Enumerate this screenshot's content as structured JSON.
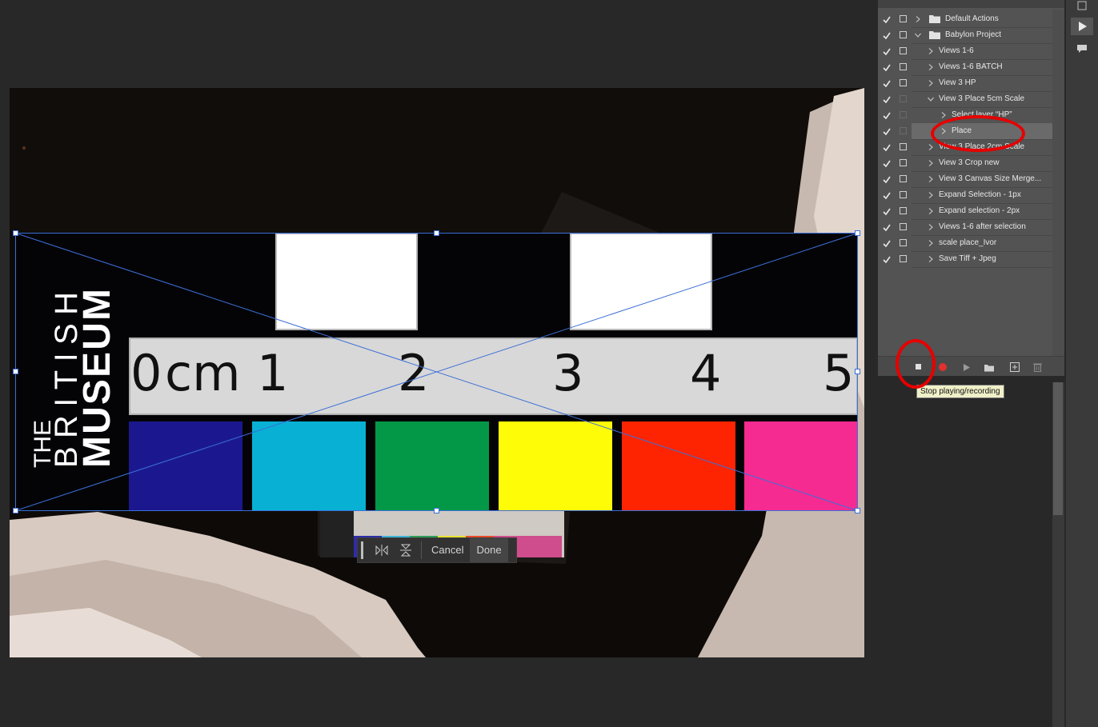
{
  "canvas_toolbar": {
    "cancel_label": "Cancel",
    "done_label": "Done"
  },
  "scale_image": {
    "museum_text": [
      "THE",
      "BRITISH",
      "MUSEUM"
    ],
    "ruler_numbers": [
      "0",
      "cm",
      "1",
      "2",
      "3",
      "4",
      "5"
    ],
    "swatch_colors": [
      "#1b188f",
      "#08b1d4",
      "#039847",
      "#fffc08",
      "#fe2402",
      "#f62b91"
    ]
  },
  "actions_panel": {
    "items": [
      {
        "label": "Default Actions",
        "type": "set",
        "indent": 0,
        "expanded": false,
        "checked": true,
        "dialog": true
      },
      {
        "label": "Babylon Project",
        "type": "set",
        "indent": 0,
        "expanded": true,
        "checked": true,
        "dialog": true
      },
      {
        "label": "Views 1-6",
        "type": "action",
        "indent": 1,
        "expanded": false,
        "checked": true,
        "dialog": true
      },
      {
        "label": "Views 1-6 BATCH",
        "type": "action",
        "indent": 1,
        "expanded": false,
        "checked": true,
        "dialog": true
      },
      {
        "label": "View 3 HP",
        "type": "action",
        "indent": 1,
        "expanded": false,
        "checked": true,
        "dialog": true
      },
      {
        "label": "View 3 Place 5cm Scale",
        "type": "action",
        "indent": 1,
        "expanded": true,
        "checked": true,
        "dialog": false
      },
      {
        "label": "Select layer “HP”",
        "type": "step",
        "indent": 2,
        "expanded": false,
        "checked": true,
        "dialog": false
      },
      {
        "label": "Place",
        "type": "step",
        "indent": 2,
        "expanded": false,
        "checked": true,
        "dialog": false,
        "selected": true
      },
      {
        "label": "View 3 Place 2cm Scale",
        "type": "action",
        "indent": 1,
        "expanded": false,
        "checked": true,
        "dialog": true
      },
      {
        "label": "View 3 Crop new",
        "type": "action",
        "indent": 1,
        "expanded": false,
        "checked": true,
        "dialog": true
      },
      {
        "label": "View 3 Canvas Size Merge...",
        "type": "action",
        "indent": 1,
        "expanded": false,
        "checked": true,
        "dialog": true
      },
      {
        "label": "Expand Selection - 1px",
        "type": "action",
        "indent": 1,
        "expanded": false,
        "checked": true,
        "dialog": true
      },
      {
        "label": "Expand selection - 2px",
        "type": "action",
        "indent": 1,
        "expanded": false,
        "checked": true,
        "dialog": true
      },
      {
        "label": "Views 1-6 after selection",
        "type": "action",
        "indent": 1,
        "expanded": false,
        "checked": true,
        "dialog": true
      },
      {
        "label": "scale place_Ivor",
        "type": "action",
        "indent": 1,
        "expanded": false,
        "checked": true,
        "dialog": true
      },
      {
        "label": "Save Tiff + Jpeg",
        "type": "action",
        "indent": 1,
        "expanded": false,
        "checked": true,
        "dialog": true
      }
    ],
    "tooltip": "Stop playing/recording",
    "footer_icons": [
      "stop-icon",
      "record-icon",
      "play-icon",
      "new-set-icon",
      "new-action-icon",
      "trash-icon"
    ]
  },
  "annotation_color": "#e60000",
  "accent_color": "#3c6fd8"
}
